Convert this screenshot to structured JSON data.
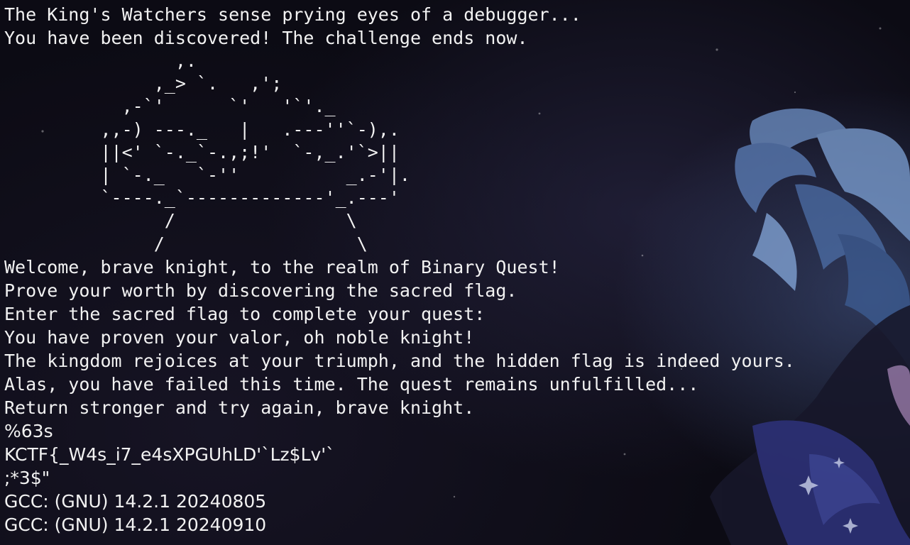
{
  "terminal": {
    "lines_top": [
      "The King's Watchers sense prying eyes of a debugger...",
      "You have been discovered! The challenge ends now."
    ],
    "ascii_art": "                ,.\n              ,_> `.   ,';\n           ,-`'      `'   '`'._\n         ,,-) ---._   |   .---''`-),.\n         ||<' `-._`-.,;!'  `-,_.'`>||\n         | `-._   `-''          _.-'|.\n         `----._`-------------'_.---'\n               /                \\\n              /                  \\",
    "lines_bottom": [
      "Welcome, brave knight, to the realm of Binary Quest!",
      "Prove your worth by discovering the sacred flag.",
      "Enter the sacred flag to complete your quest:",
      "You have proven your valor, oh noble knight!",
      "The kingdom rejoices at your triumph, and the hidden flag is indeed yours.",
      "Alas, you have failed this time. The quest remains unfulfilled...",
      "Return stronger and try again, brave knight."
    ],
    "strings_output": [
      "%63s",
      "KCTF{_W4s_i7_e4sXPGUhLD'`Lz$Lv'`",
      ";*3$\"",
      "GCC: (GNU) 14.2.1 20240805",
      "GCC: (GNU) 14.2.1 20240910"
    ]
  },
  "theme": {
    "text_color": "#f2f2f2",
    "background": "#0c0b14",
    "accent_hair": "#7fa3d9",
    "accent_cloak": "#3a3f8c"
  }
}
